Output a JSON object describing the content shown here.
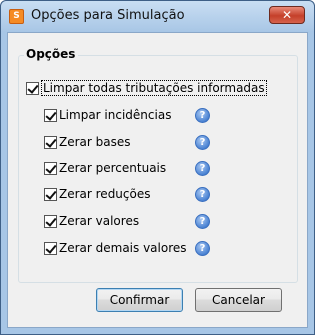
{
  "window": {
    "title": "Opções para Simulação",
    "app_icon_glyph": "S",
    "close_glyph": "✕"
  },
  "options": {
    "group_title": "Opções",
    "master": {
      "label": "Limpar todas tributações informadas",
      "checked": true
    },
    "items": [
      {
        "label": "Limpar incidências",
        "checked": true,
        "help_icon": "help-icon"
      },
      {
        "label": "Zerar bases",
        "checked": true,
        "help_icon": "help-icon"
      },
      {
        "label": "Zerar percentuais",
        "checked": true,
        "help_icon": "help-icon"
      },
      {
        "label": "Zerar reduções",
        "checked": true,
        "help_icon": "help-icon"
      },
      {
        "label": "Zerar valores",
        "checked": true,
        "help_icon": "help-icon"
      },
      {
        "label": "Zerar demais valores",
        "checked": true,
        "help_icon": "help-icon"
      }
    ],
    "help_glyph": "?"
  },
  "buttons": {
    "confirm": "Confirmar",
    "cancel": "Cancelar"
  },
  "colors": {
    "title_bar": "#b4d0ee",
    "close_button": "#c5402a",
    "help_icon": "#4b83d3",
    "dialog_bg": "#f0f0f0"
  }
}
